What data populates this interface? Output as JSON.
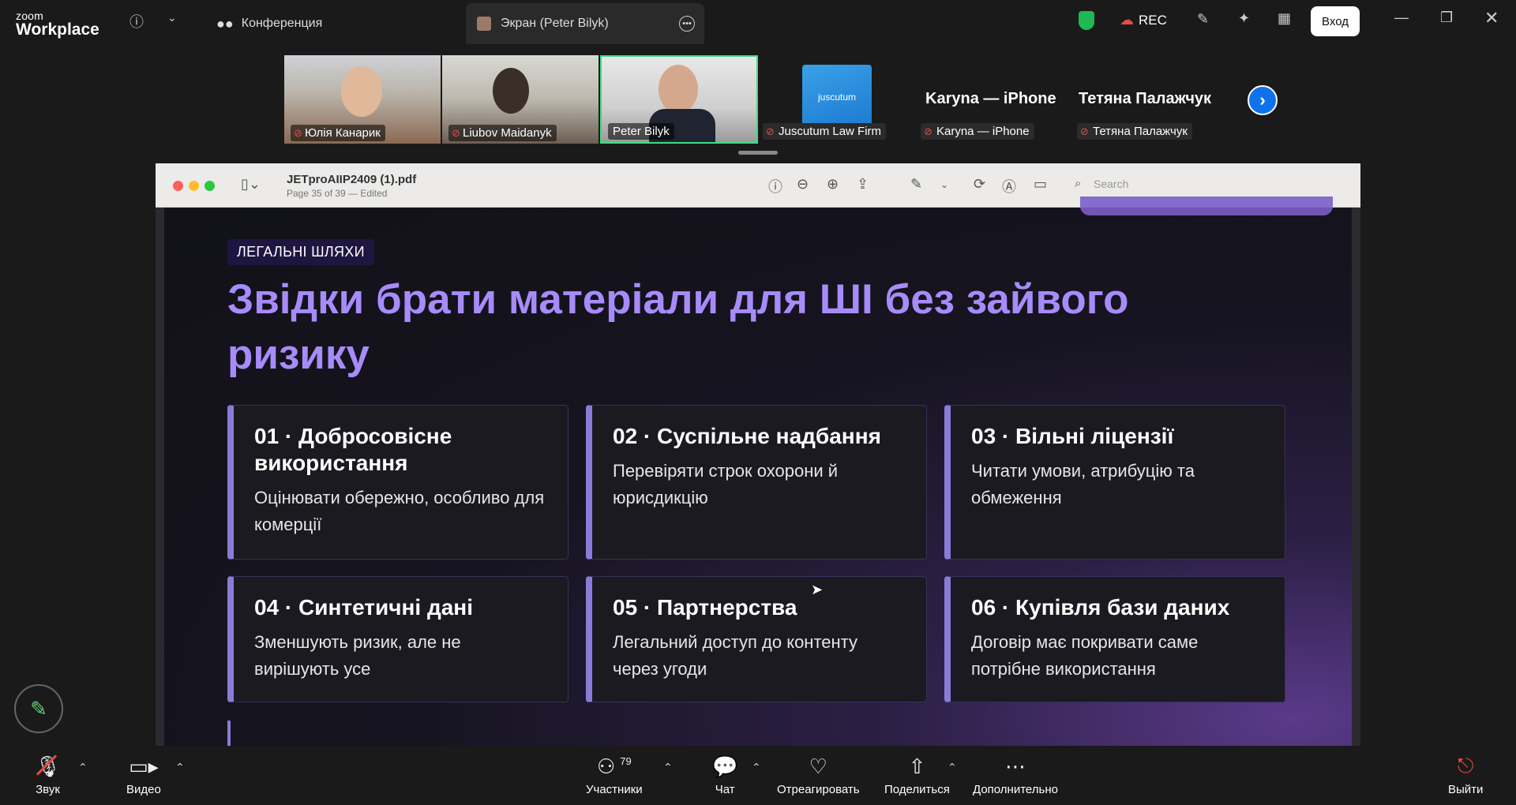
{
  "app": {
    "logo_small": "zoom",
    "logo_big": "Workplace",
    "tabs": [
      {
        "label": "Конференция",
        "icon": "people-icon"
      },
      {
        "label": "Экран (Peter Bilyk)",
        "icon": "avatar-icon"
      }
    ],
    "rec_label": "REC",
    "login_label": "Вход"
  },
  "participants": [
    {
      "name": "Юлія Канарик",
      "muted": true
    },
    {
      "name": "Liubov Maidanyk",
      "muted": true
    },
    {
      "name": "Peter Bilyk",
      "muted": false,
      "active_speaker": true
    },
    {
      "name": "Juscutum Law Firm",
      "muted": true,
      "logo_text": "juscutum"
    },
    {
      "name": "Karyna — iPhone",
      "muted": true
    },
    {
      "name": "Тетяна Палажчук",
      "muted": true
    }
  ],
  "pdf": {
    "filename": "JETproAIIP2409 (1).pdf",
    "subtitle": "Page 35 of 39 — Edited",
    "search_placeholder": "Search"
  },
  "slide": {
    "badge": "ЛЕГАЛЬНІ ШЛЯХИ",
    "headline": "Звідки брати матеріали для ШІ без зайвого ризику",
    "cards": [
      {
        "title": "01 · Добросовісне використання",
        "text": "Оцінювати обережно, особливо для комерції"
      },
      {
        "title": "02 · Суспільне надбання",
        "text": "Перевіряти строк охорони й юрисдикцію"
      },
      {
        "title": "03 · Вільні ліцензії",
        "text": "Читати умови, атрибуцію та обмеження"
      },
      {
        "title": "04 · Синтетичні дані",
        "text": "Зменшують ризик, але не вирішують усе"
      },
      {
        "title": "05 · Партнерства",
        "text": "Легальний доступ до контенту через угоди"
      },
      {
        "title": "06 · Купівля бази даних",
        "text": "Договір має покривати саме потрібне використання"
      }
    ]
  },
  "toolbar": {
    "audio": "Звук",
    "video": "Видео",
    "participants": "Участники",
    "participants_count": "79",
    "chat": "Чат",
    "react": "Отреагировать",
    "share": "Поделиться",
    "more": "Дополнительно",
    "leave": "Выйти"
  },
  "colors": {
    "accent_purple": "#a78bfa",
    "zoom_blue": "#0e72ed",
    "active_speaker_border": "#3ddc84"
  }
}
